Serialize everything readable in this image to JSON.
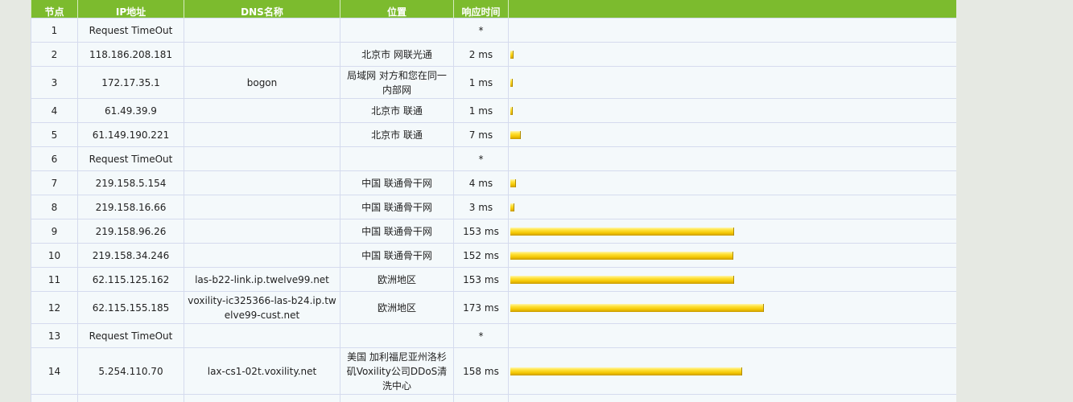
{
  "table": {
    "headers": [
      "节点",
      "IP地址",
      "DNS名称",
      "位置",
      "响应时间",
      ""
    ],
    "bar_color": "#f2c400",
    "header_color": "#7cbb2e",
    "rows": [
      {
        "hop": "1",
        "ip": "Request TimeOut",
        "dns": "",
        "location": "",
        "time": "*",
        "ms": 0
      },
      {
        "hop": "2",
        "ip": "118.186.208.181",
        "dns": "",
        "location": "北京市 网联光通",
        "time": "2 ms",
        "ms": 2
      },
      {
        "hop": "3",
        "ip": "172.17.35.1",
        "dns": "bogon",
        "location": "局域网 对方和您在同一内部网",
        "time": "1 ms",
        "ms": 1
      },
      {
        "hop": "4",
        "ip": "61.49.39.9",
        "dns": "",
        "location": "北京市 联通",
        "time": "1 ms",
        "ms": 1
      },
      {
        "hop": "5",
        "ip": "61.149.190.221",
        "dns": "",
        "location": "北京市 联通",
        "time": "7 ms",
        "ms": 7
      },
      {
        "hop": "6",
        "ip": "Request TimeOut",
        "dns": "",
        "location": "",
        "time": "*",
        "ms": 0
      },
      {
        "hop": "7",
        "ip": "219.158.5.154",
        "dns": "",
        "location": "中国 联通骨干网",
        "time": "4 ms",
        "ms": 4
      },
      {
        "hop": "8",
        "ip": "219.158.16.66",
        "dns": "",
        "location": "中国 联通骨干网",
        "time": "3 ms",
        "ms": 3
      },
      {
        "hop": "9",
        "ip": "219.158.96.26",
        "dns": "",
        "location": "中国 联通骨干网",
        "time": "153 ms",
        "ms": 153
      },
      {
        "hop": "10",
        "ip": "219.158.34.246",
        "dns": "",
        "location": "中国 联通骨干网",
        "time": "152 ms",
        "ms": 152
      },
      {
        "hop": "11",
        "ip": "62.115.125.162",
        "dns": "las-b22-link.ip.twelve99.net",
        "location": "欧洲地区",
        "time": "153 ms",
        "ms": 153
      },
      {
        "hop": "12",
        "ip": "62.115.155.185",
        "dns": "voxility-ic325366-las-b24.ip.twelve99-cust.net",
        "location": "欧洲地区",
        "time": "173 ms",
        "ms": 173
      },
      {
        "hop": "13",
        "ip": "Request TimeOut",
        "dns": "",
        "location": "",
        "time": "*",
        "ms": 0
      },
      {
        "hop": "14",
        "ip": "5.254.110.70",
        "dns": "lax-cs1-02t.voxility.net",
        "location": "美国 加利福尼亚州洛杉矶Voxility公司DDoS清洗中心",
        "time": "158 ms",
        "ms": 158
      }
    ]
  }
}
